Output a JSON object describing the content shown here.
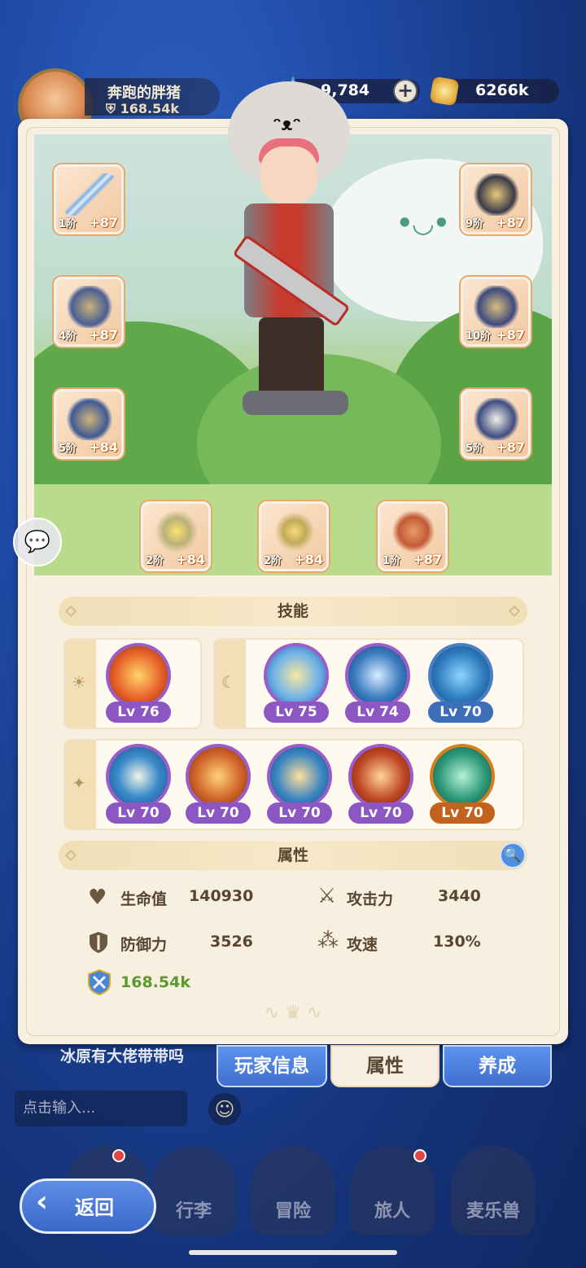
{
  "player": {
    "name": "奔跑的胖猪",
    "power": "168.54k"
  },
  "currency": {
    "gems": "9,784",
    "gold": "6266k"
  },
  "equipment": {
    "left": [
      {
        "name": "sword",
        "tier": "1阶",
        "plus": "+87"
      },
      {
        "name": "chest-armor",
        "tier": "4阶",
        "plus": "+87"
      },
      {
        "name": "leg-armor",
        "tier": "5阶",
        "plus": "+84"
      }
    ],
    "right": [
      {
        "name": "helmet",
        "tier": "9阶",
        "plus": "+87"
      },
      {
        "name": "gauntlets",
        "tier": "10阶",
        "plus": "+87"
      },
      {
        "name": "boots",
        "tier": "5阶",
        "plus": "+87"
      }
    ],
    "bottom": [
      {
        "name": "ring",
        "tier": "2阶",
        "plus": "+84"
      },
      {
        "name": "necklace",
        "tier": "2阶",
        "plus": "+84"
      },
      {
        "name": "charm",
        "tier": "1阶",
        "plus": "+87"
      }
    ]
  },
  "skills": {
    "header": "技能",
    "group1": [
      {
        "level": "Lv 76",
        "color": "#e2571e"
      }
    ],
    "group2": [
      {
        "level": "Lv 75",
        "color": "#3b87c9"
      },
      {
        "level": "Lv 74",
        "color": "#2f6fa8"
      },
      {
        "level": "Lv 70",
        "color": "#2f7dbf"
      }
    ],
    "group3": [
      {
        "level": "Lv 70",
        "color": "#2b7cb8"
      },
      {
        "level": "Lv 70",
        "color": "#c85a22"
      },
      {
        "level": "Lv 70",
        "color": "#3b86c2"
      },
      {
        "level": "Lv 70",
        "color": "#c04a25"
      },
      {
        "level": "Lv 70",
        "color": "#2e9a7a"
      }
    ]
  },
  "attributes": {
    "header": "属性",
    "hp_label": "生命值",
    "hp_value": "140930",
    "atk_label": "攻击力",
    "atk_value": "3440",
    "def_label": "防御力",
    "def_value": "3526",
    "spd_label": "攻速",
    "spd_value": "130%",
    "power_value": "168.54k"
  },
  "tabs": {
    "info": "玩家信息",
    "attrs": "属性",
    "train": "养成"
  },
  "chat": {
    "message": "冰原有大佬带带吗",
    "placeholder": "点击输入..."
  },
  "nav": {
    "bag": "行李",
    "adventure": "冒险",
    "traveler": "旅人",
    "pet": "麦乐兽",
    "back": "返回"
  },
  "colors": {
    "accent": "#4d7fe0",
    "panel": "#f7efdf",
    "skill_border": "#9b5dc9",
    "power_green": "#5a9a2a"
  }
}
